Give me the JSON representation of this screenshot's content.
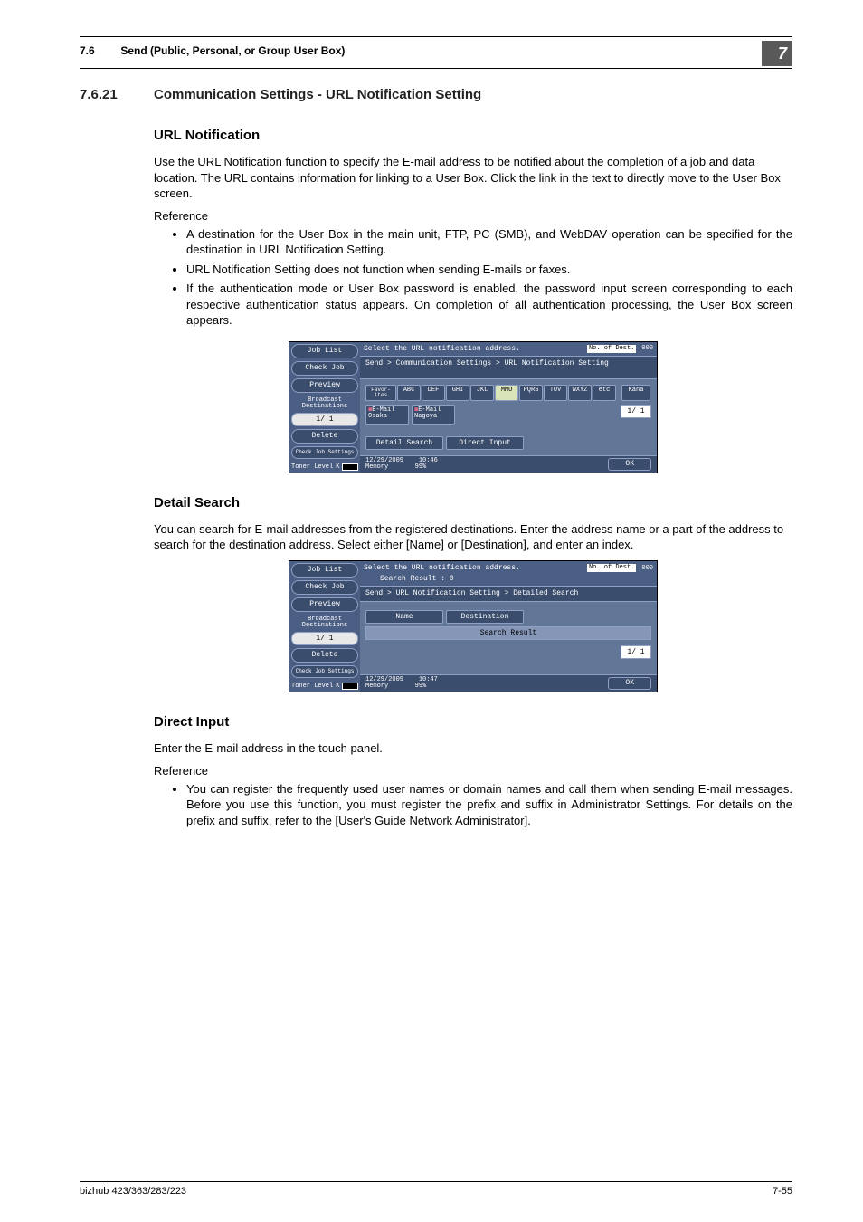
{
  "header": {
    "section_number": "7.6",
    "section_title": "Send (Public, Personal, or Group User Box)",
    "badge": "7"
  },
  "section": {
    "number": "7.6.21",
    "title": "Communication Settings - URL Notification Setting"
  },
  "url_notif": {
    "heading": "URL Notification",
    "para": "Use the URL Notification function to specify the E-mail address to be notified about the completion of a job and data location. The URL contains information for linking to a User Box. Click the link in the text to directly move to the User Box screen.",
    "ref_label": "Reference",
    "bullets": [
      "A destination for the User Box in the main unit, FTP, PC (SMB), and WebDAV operation can be specified for the destination in URL Notification Setting.",
      "URL Notification Setting does not function when sending E-mails or faxes.",
      "If the authentication mode or User Box password is enabled, the password input screen corresponding to each respective authentication status appears. On completion of all authentication processing, the User Box screen appears."
    ]
  },
  "detail_search": {
    "heading": "Detail Search",
    "para": "You can search for E-mail addresses from the registered destinations. Enter the address name or a part of the address to search for the destination address. Select either [Name] or [Destination], and enter an index."
  },
  "direct_input": {
    "heading": "Direct Input",
    "para": "Enter the E-mail address in the touch panel.",
    "ref_label": "Reference",
    "bullets": [
      "You can register the frequently used user names or domain names and call them when sending E-mail messages. Before you use this function, you must register the prefix and suffix in Administrator Settings. For details on the prefix and suffix, refer to the [User's Guide Network Administrator]."
    ]
  },
  "screen_common": {
    "left": {
      "job_list": "Job List",
      "check_job": "Check Job",
      "preview": "Preview",
      "broadcast": "Broadcast Destinations",
      "page": "1/ 1",
      "delete": "Delete",
      "check_setting": "Check Job Settings",
      "toner": "Toner Level",
      "toner_k": "K"
    },
    "msg": "Select the URL notification address.",
    "no_of_dest_lbl": "No. of Dest.",
    "no_of_dest_val": "000",
    "ok": "OK"
  },
  "screen1": {
    "crumb": "Send > Communication Settings > URL Notification Setting",
    "tabs": {
      "favor": "Favor- ites",
      "keys": [
        "ABC",
        "DEF",
        "GHI",
        "JKL",
        "MNO",
        "PQRS",
        "TUV",
        "WXYZ",
        "etc"
      ],
      "kana": "Kana",
      "selected": "MNO"
    },
    "dests": [
      {
        "type": "E-Mail",
        "name": "Osaka"
      },
      {
        "type": "E-Mail",
        "name": "Nagoya"
      }
    ],
    "side_page": "1/ 1",
    "detail_search": "Detail Search",
    "direct_input": "Direct Input",
    "date": "12/29/2009",
    "time": "10:46",
    "memory_lbl": "Memory",
    "memory_val": "99%"
  },
  "screen2": {
    "search_result_line": "Search Result   :   0",
    "crumb": "Send > URL Notification Setting > Detailed Search",
    "name_btn": "Name",
    "dest_btn": "Destination",
    "result_bar": "Search Result",
    "side_page": "1/ 1",
    "date": "12/29/2009",
    "time": "10:47",
    "memory_lbl": "Memory",
    "memory_val": "99%"
  },
  "footer": {
    "left": "bizhub 423/363/283/223",
    "right": "7-55"
  }
}
